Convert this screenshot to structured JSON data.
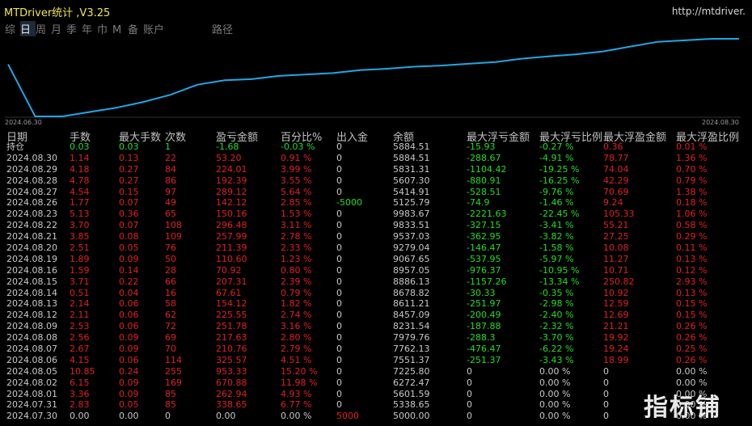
{
  "window": {
    "title": "MTDriver统计 ,V3.25",
    "url": "http://mtdriver."
  },
  "tabs": [
    "综",
    "日",
    "周",
    "月",
    "季",
    "年",
    "巾",
    "M",
    "备",
    "账户",
    "路径"
  ],
  "chart_data": {
    "type": "line",
    "x_start_label": "2024.06.30",
    "x_end_label": "2024.08.30",
    "series": [
      {
        "values": [
          5000,
          3200,
          3200,
          3350,
          3500,
          3700,
          3950,
          4300,
          4450,
          4490,
          4600,
          4650,
          4700,
          4800,
          4850,
          4920,
          4960,
          5020,
          5080,
          5200,
          5280,
          5350,
          5450,
          5620,
          5780,
          5830,
          5884.51,
          5884.51
        ]
      }
    ],
    "color": "#1fa7e6"
  },
  "columns": [
    "日期",
    "手数",
    "最大手数",
    "次数",
    "盈亏金额",
    "百分比%",
    "出入金",
    "余额",
    "最大浮亏金额",
    "最大浮亏比例",
    "最大浮盈金额",
    "最大浮盈比例"
  ],
  "rows": [
    [
      "持仓",
      "0.03",
      "0.03",
      "1",
      "-1.68",
      "-0.03 %",
      "0",
      "5884.51",
      "-15.93",
      "-0.27 %",
      "0.36",
      "0.01 %"
    ],
    [
      "2024.08.30",
      "1.14",
      "0.13",
      "22",
      "53.20",
      "0.91 %",
      "0",
      "5884.51",
      "-288.67",
      "-4.91 %",
      "78.77",
      "1.36 %"
    ],
    [
      "2024.08.29",
      "4.18",
      "0.27",
      "84",
      "224.01",
      "3.99 %",
      "0",
      "5831.31",
      "-1104.42",
      "-19.25 %",
      "74.04",
      "0.70 %"
    ],
    [
      "2024.08.28",
      "4.78",
      "0.27",
      "86",
      "192.39",
      "3.55 %",
      "0",
      "5607.30",
      "-880.91",
      "-16.25 %",
      "42.29",
      "0.79 %"
    ],
    [
      "2024.08.27",
      "4.54",
      "0.15",
      "97",
      "289.12",
      "5.64 %",
      "0",
      "5414.91",
      "-528.51",
      "-9.76 %",
      "70.69",
      "1.38 %"
    ],
    [
      "2024.08.26",
      "1.77",
      "0.07",
      "49",
      "142.12",
      "2.85 %",
      "-5000",
      "5125.79",
      "-74.9",
      "-1.46 %",
      "9.24",
      "0.18 %"
    ],
    [
      "2024.08.23",
      "5.13",
      "0.36",
      "65",
      "150.16",
      "1.53 %",
      "0",
      "9983.67",
      "-2221.63",
      "-22.45 %",
      "105.33",
      "1.06 %"
    ],
    [
      "2024.08.22",
      "3.70",
      "0.07",
      "108",
      "296.48",
      "3.11 %",
      "0",
      "9833.51",
      "-327.15",
      "-3.41 %",
      "55.21",
      "0.58 %"
    ],
    [
      "2024.08.21",
      "3.85",
      "0.08",
      "109",
      "257.99",
      "2.78 %",
      "0",
      "9537.03",
      "-362.95",
      "-3.82 %",
      "27.25",
      "0.29 %"
    ],
    [
      "2024.08.20",
      "2.51",
      "0.05",
      "76",
      "211.39",
      "2.33 %",
      "0",
      "9279.04",
      "-146.47",
      "-1.58 %",
      "10.08",
      "0.11 %"
    ],
    [
      "2024.08.19",
      "1.89",
      "0.09",
      "50",
      "110.60",
      "1.23 %",
      "0",
      "9067.65",
      "-537.95",
      "-5.97 %",
      "11.27",
      "0.13 %"
    ],
    [
      "2024.08.16",
      "1.59",
      "0.14",
      "28",
      "70.92",
      "0.80 %",
      "0",
      "8957.05",
      "-976.37",
      "-10.95 %",
      "10.71",
      "0.12 %"
    ],
    [
      "2024.08.15",
      "3.71",
      "0.22",
      "66",
      "207.31",
      "2.39 %",
      "0",
      "8886.13",
      "-1157.26",
      "-13.34 %",
      "250.82",
      "2.93 %"
    ],
    [
      "2024.08.14",
      "0.51",
      "0.04",
      "16",
      "67.61",
      "0.79 %",
      "0",
      "8678.82",
      "-30.33",
      "-0.35 %",
      "10.92",
      "0.13 %"
    ],
    [
      "2024.08.13",
      "2.14",
      "0.06",
      "58",
      "154.12",
      "1.82 %",
      "0",
      "8611.21",
      "-251.97",
      "-2.98 %",
      "12.59",
      "0.15 %"
    ],
    [
      "2024.08.12",
      "2.11",
      "0.06",
      "62",
      "225.55",
      "2.74 %",
      "0",
      "8457.09",
      "-200.49",
      "-2.40 %",
      "12.69",
      "0.15 %"
    ],
    [
      "2024.08.09",
      "2.53",
      "0.06",
      "72",
      "251.78",
      "3.16 %",
      "0",
      "8231.54",
      "-187.88",
      "-2.32 %",
      "21.21",
      "0.26 %"
    ],
    [
      "2024.08.08",
      "2.56",
      "0.09",
      "69",
      "217.63",
      "2.80 %",
      "0",
      "7979.76",
      "-288.3",
      "-3.70 %",
      "19.92",
      "0.26 %"
    ],
    [
      "2024.08.07",
      "2.67",
      "0.09",
      "70",
      "210.76",
      "2.79 %",
      "0",
      "7762.13",
      "-476.47",
      "-6.22 %",
      "19.24",
      "0.25 %"
    ],
    [
      "2024.08.06",
      "4.15",
      "0.06",
      "114",
      "325.57",
      "4.51 %",
      "0",
      "7551.37",
      "-251.37",
      "-3.43 %",
      "18.99",
      "0.26 %"
    ],
    [
      "2024.08.05",
      "10.85",
      "0.24",
      "255",
      "953.33",
      "15.20 %",
      "0",
      "7225.80",
      "0",
      "0.00 %",
      "0",
      "0.00 %"
    ],
    [
      "2024.08.02",
      "6.15",
      "0.09",
      "169",
      "670.88",
      "11.98 %",
      "0",
      "6272.47",
      "0",
      "0.00 %",
      "0",
      "0.00 %"
    ],
    [
      "2024.08.01",
      "3.36",
      "0.09",
      "85",
      "262.94",
      "4.93 %",
      "0",
      "5601.59",
      "0",
      "0.00 %",
      "0",
      "0.00 %"
    ],
    [
      "2024.07.31",
      "2.83",
      "0.05",
      "85",
      "338.65",
      "6.77 %",
      "0",
      "5338.65",
      "0",
      "0.00 %",
      "0",
      "0.00 %"
    ],
    [
      "2024.07.30",
      "0.00",
      "0.00",
      "0",
      "0.00",
      "0.00 %",
      "5000",
      "5000.00",
      "0",
      "0.00 %",
      "0",
      "0.00 %"
    ]
  ],
  "watermark": "指标铺"
}
